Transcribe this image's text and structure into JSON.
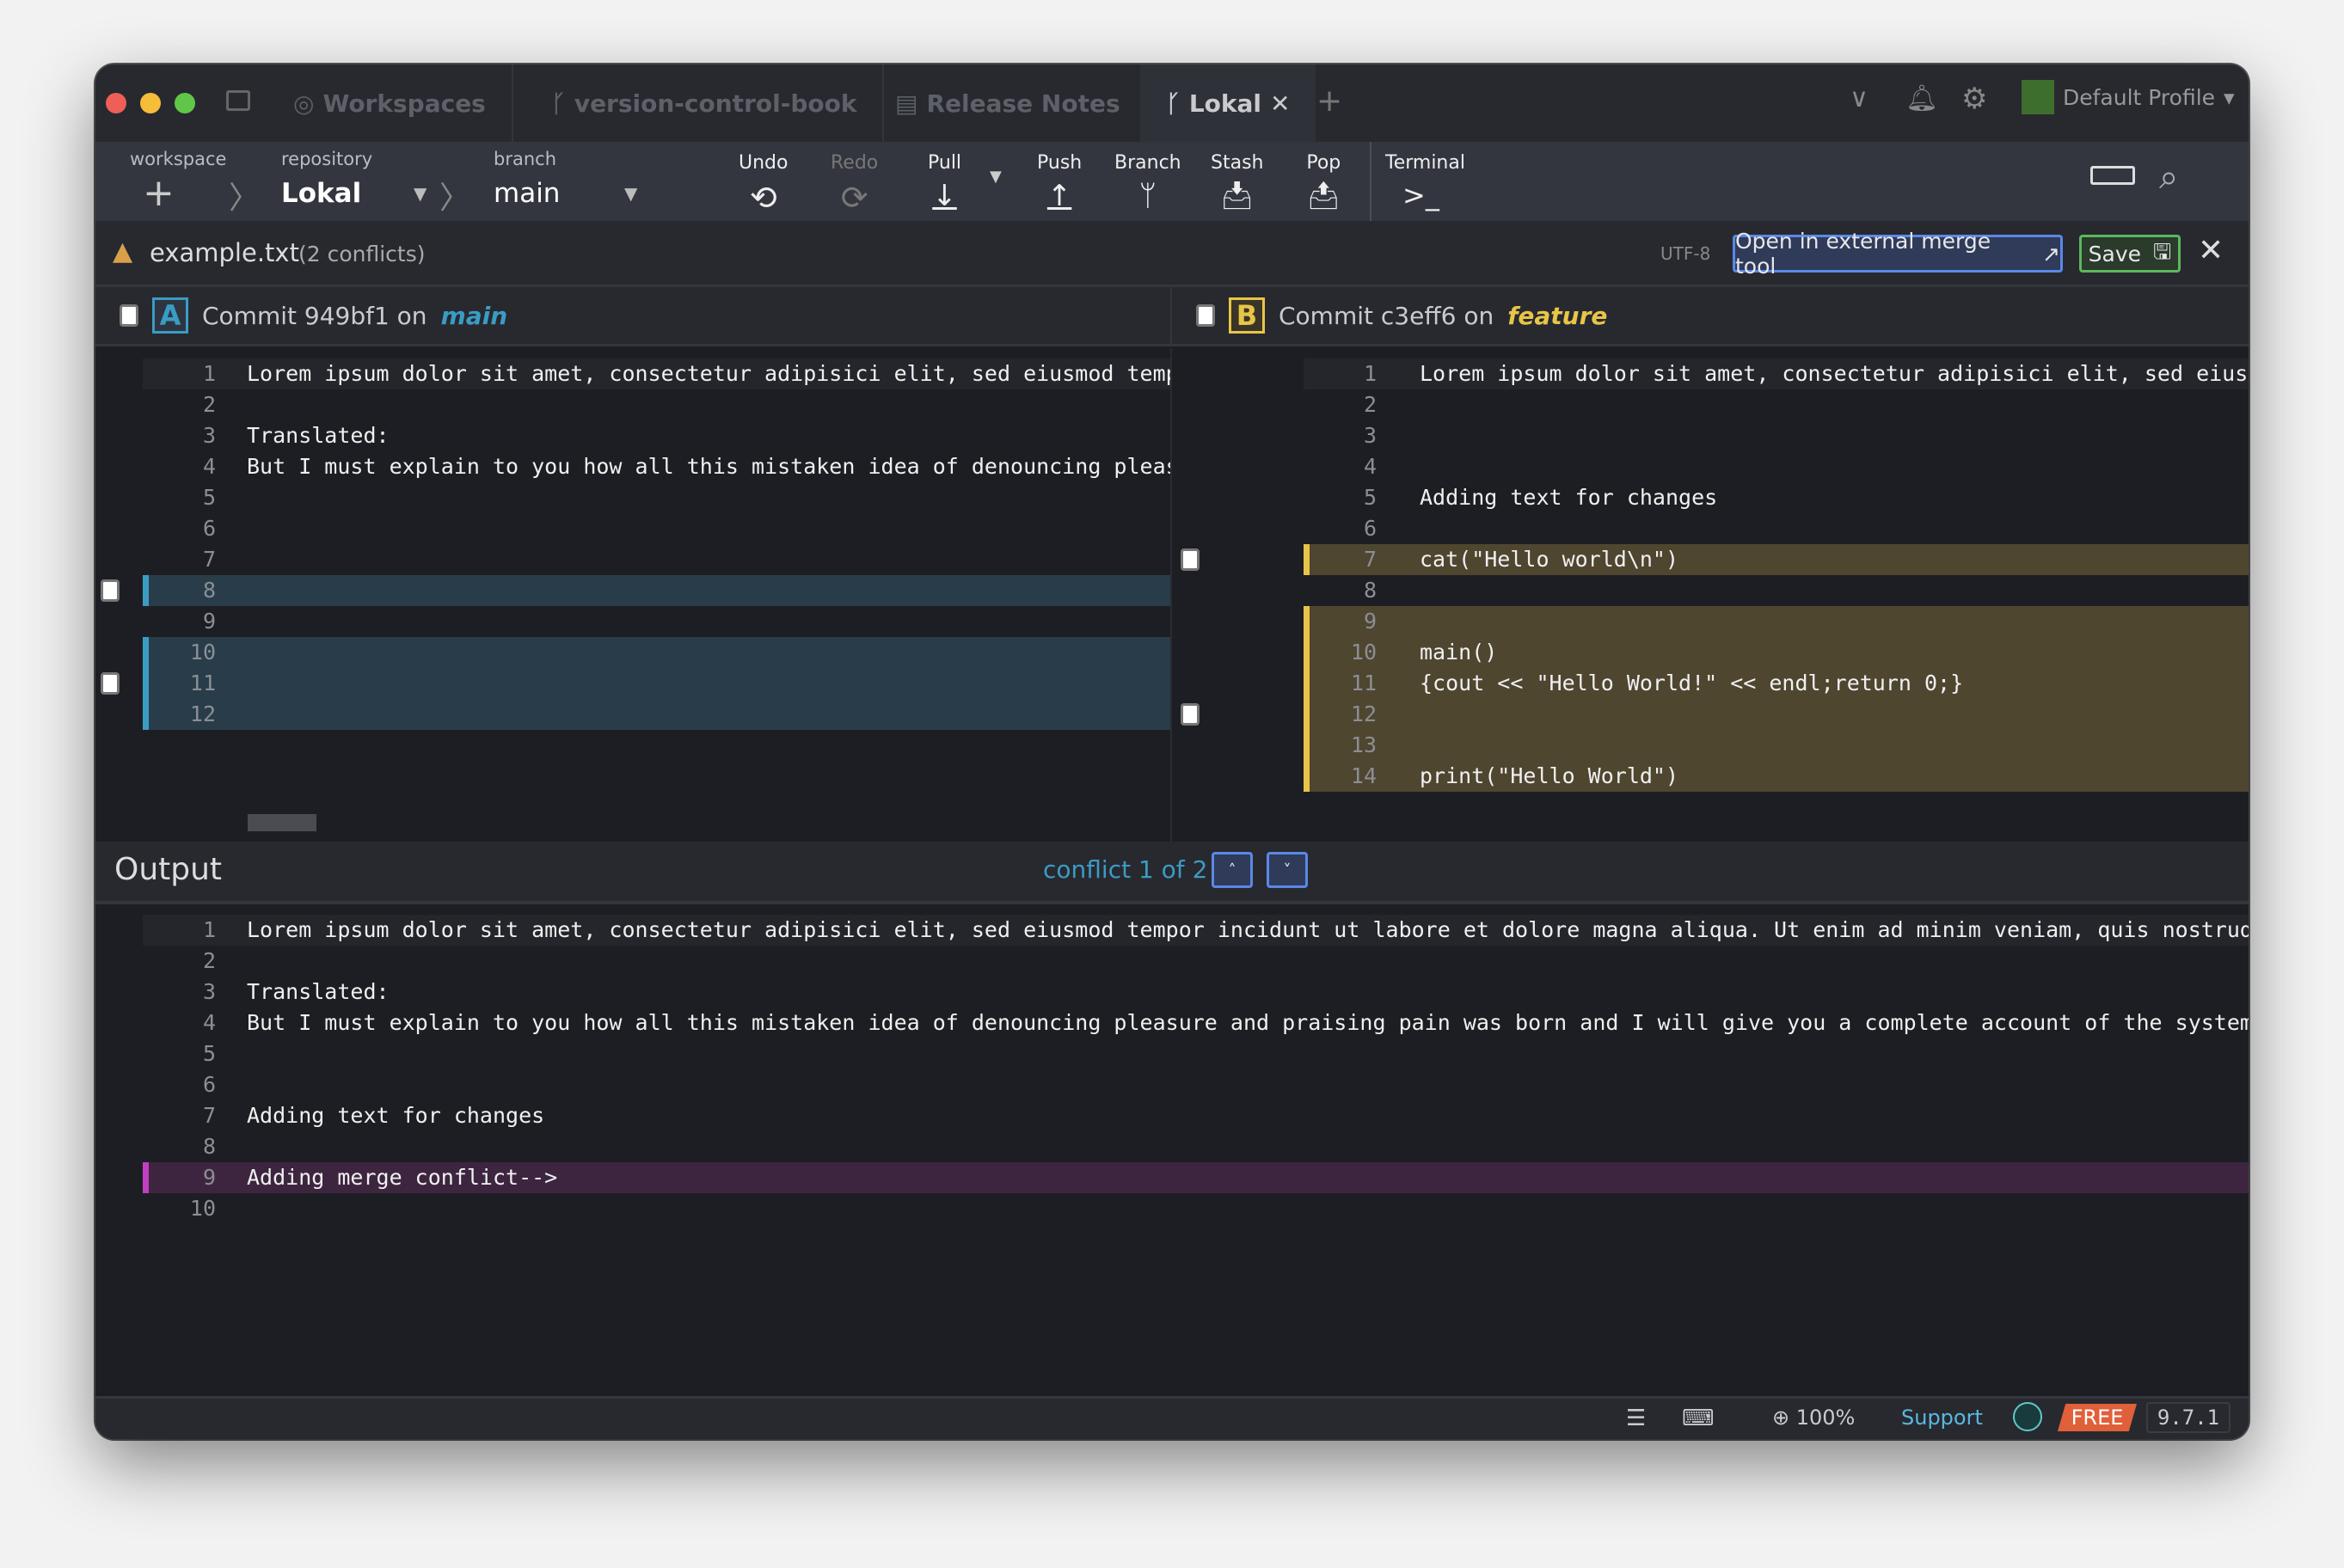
{
  "tabs": [
    {
      "label": "Workspaces",
      "icon": "workspaces-icon"
    },
    {
      "label": "version-control-book",
      "icon": "repo-branch-icon"
    },
    {
      "label": "Release Notes",
      "icon": "clipboard-icon"
    },
    {
      "label": "Lokal",
      "icon": "repo-branch-icon",
      "active": true
    }
  ],
  "profile": "Default Profile",
  "toolbar": {
    "workspace_label": "workspace",
    "repository_label": "repository",
    "repository": "Lokal",
    "branch_label": "branch",
    "branch": "main",
    "actions": [
      "Undo",
      "Redo",
      "Pull",
      "Push",
      "Branch",
      "Stash",
      "Pop",
      "Terminal"
    ]
  },
  "file": {
    "name": "example.txt",
    "conflicts": "(2 conflicts)",
    "encoding": "UTF-8",
    "external_label": "Open in external merge tool",
    "save_label": "Save"
  },
  "colors": {
    "a": "#3a9cc4",
    "b": "#e8c547",
    "output": "#c23fc0",
    "free": "#e0603a",
    "support": "#5ab8e0"
  },
  "pane_a": {
    "badge": "A",
    "commit": "Commit 949bf1 on",
    "branch": "main",
    "lines": [
      {
        "n": "1",
        "t": "Lorem ipsum dolor sit amet, consectetur adipisici elit, sed eiusmod tempor"
      },
      {
        "n": "2",
        "t": ""
      },
      {
        "n": "3",
        "t": "Translated:"
      },
      {
        "n": "4",
        "t": "But I must explain to you how all this mistaken idea of denouncing pleasure"
      },
      {
        "n": "5",
        "t": ""
      },
      {
        "n": "6",
        "t": ""
      },
      {
        "n": "7",
        "t": ""
      },
      {
        "n": "8",
        "t": "",
        "hl": true,
        "cb": true
      },
      {
        "n": "9",
        "t": ""
      },
      {
        "n": "10",
        "t": "",
        "hl": true
      },
      {
        "n": "11",
        "t": "",
        "hl": true,
        "cb": true
      },
      {
        "n": "12",
        "t": "",
        "hl": true
      }
    ]
  },
  "pane_b": {
    "badge": "B",
    "commit": "Commit c3eff6 on",
    "branch": "feature",
    "lines": [
      {
        "n": "1",
        "t": "Lorem ipsum dolor sit amet, consectetur adipisici elit, sed eiusmod tempor"
      },
      {
        "n": "2",
        "t": ""
      },
      {
        "n": "3",
        "t": ""
      },
      {
        "n": "4",
        "t": ""
      },
      {
        "n": "5",
        "t": "Adding text for changes"
      },
      {
        "n": "6",
        "t": ""
      },
      {
        "n": "7",
        "t": "cat(\"Hello world\\n\")",
        "hl": true,
        "cb": true
      },
      {
        "n": "8",
        "t": ""
      },
      {
        "n": "9",
        "t": "",
        "hl": true
      },
      {
        "n": "10",
        "t": "main()",
        "hl": true
      },
      {
        "n": "11",
        "t": "{cout << \"Hello World!\" << endl;return 0;}",
        "hl": true
      },
      {
        "n": "12",
        "t": "",
        "hl": true,
        "cb": true
      },
      {
        "n": "13",
        "t": "",
        "hl": true
      },
      {
        "n": "14",
        "t": "print(\"Hello World\")",
        "hl": true
      }
    ]
  },
  "output": {
    "title": "Output",
    "conflict_nav": "conflict 1 of 2",
    "lines": [
      {
        "n": "1",
        "t": "Lorem ipsum dolor sit amet, consectetur adipisici elit, sed eiusmod tempor incidunt ut labore et dolore magna aliqua. Ut enim ad minim veniam, quis nostrud exercitation"
      },
      {
        "n": "2",
        "t": ""
      },
      {
        "n": "3",
        "t": "Translated:"
      },
      {
        "n": "4",
        "t": "But I must explain to you how all this mistaken idea of denouncing pleasure and praising pain was born and I will give you a complete account of the system, and expound"
      },
      {
        "n": "5",
        "t": ""
      },
      {
        "n": "6",
        "t": ""
      },
      {
        "n": "7",
        "t": "Adding text for changes"
      },
      {
        "n": "8",
        "t": ""
      },
      {
        "n": "9",
        "t": "Adding merge conflict-->",
        "hl": true
      },
      {
        "n": "10",
        "t": ""
      }
    ]
  },
  "status": {
    "zoom": "100%",
    "support": "Support",
    "plan": "FREE",
    "version": "9.7.1"
  }
}
